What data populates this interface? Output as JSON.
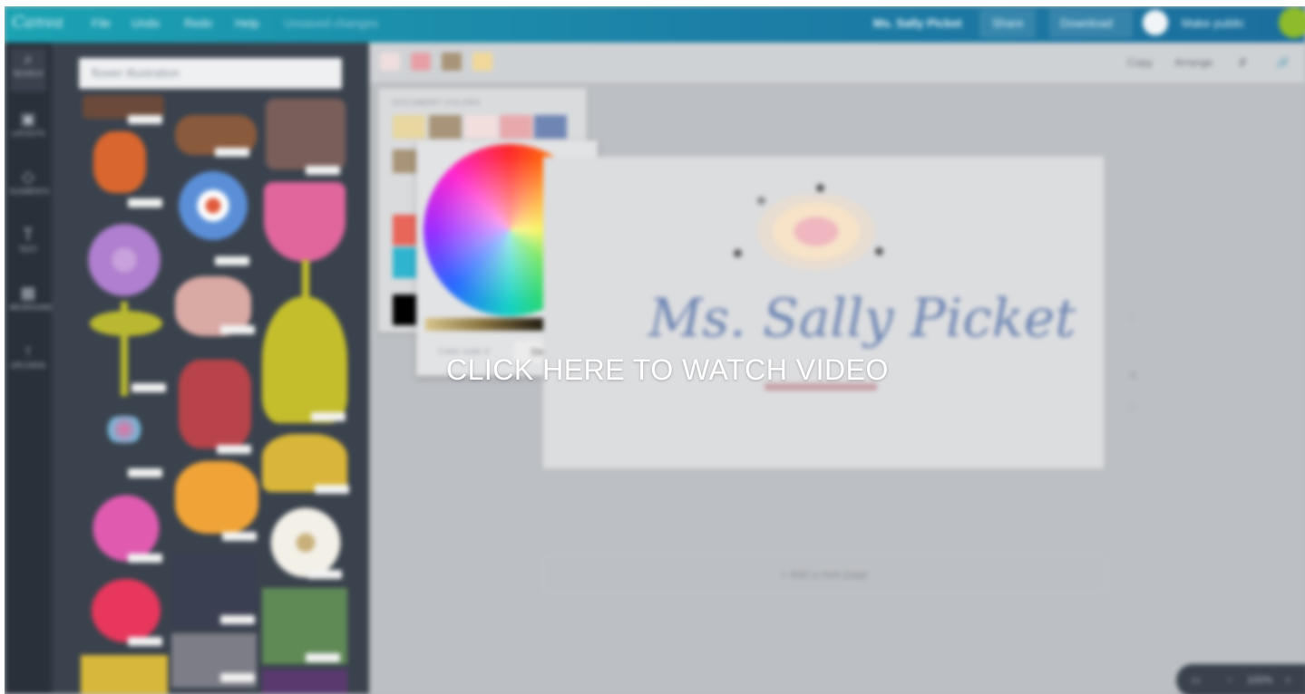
{
  "overlay": {
    "cta_text": "CLICK HERE TO WATCH VIDEO"
  },
  "topbar": {
    "logo": "Canva",
    "menu": [
      "File",
      "Undo",
      "Redo",
      "Help"
    ],
    "status": "Unsaved changes",
    "doc_title": "Ms. Sally Picket",
    "share_label": "Share",
    "download_label": "Download",
    "visibility_label": "Make public"
  },
  "rail": {
    "tools": [
      "SEARCH",
      "LAYOUTS",
      "ELEMENTS",
      "TEXT",
      "BKGROUND",
      "UPLOADS"
    ]
  },
  "panel": {
    "search_value": "flower illustration"
  },
  "toolbar": {
    "swatches": [
      "#f0dede",
      "#e6a0a6",
      "#a89478",
      "#f2d89a"
    ],
    "copy_label": "Copy",
    "arrange_label": "Arrange"
  },
  "colorpanel": {
    "heading": "DOCUMENT COLORS",
    "doc_colors": [
      "#e8d79f",
      "#a89478",
      "#f3dede",
      "#e8a9ad",
      "#6f86b5"
    ],
    "palette": [
      "#e8655a",
      "#2fb4cf",
      "#000000"
    ],
    "picker_caption": "Color code #",
    "done_label": "Done"
  },
  "canvas": {
    "brand_text": "Ms. Sally Picket",
    "add_page_label": "+ Add a new page"
  },
  "zoom": {
    "level": "100%"
  },
  "colors": {
    "topbar": "#1c8fae",
    "rail": "#293039",
    "panel": "#3a424d",
    "editor_bg": "#bcbfc3"
  }
}
